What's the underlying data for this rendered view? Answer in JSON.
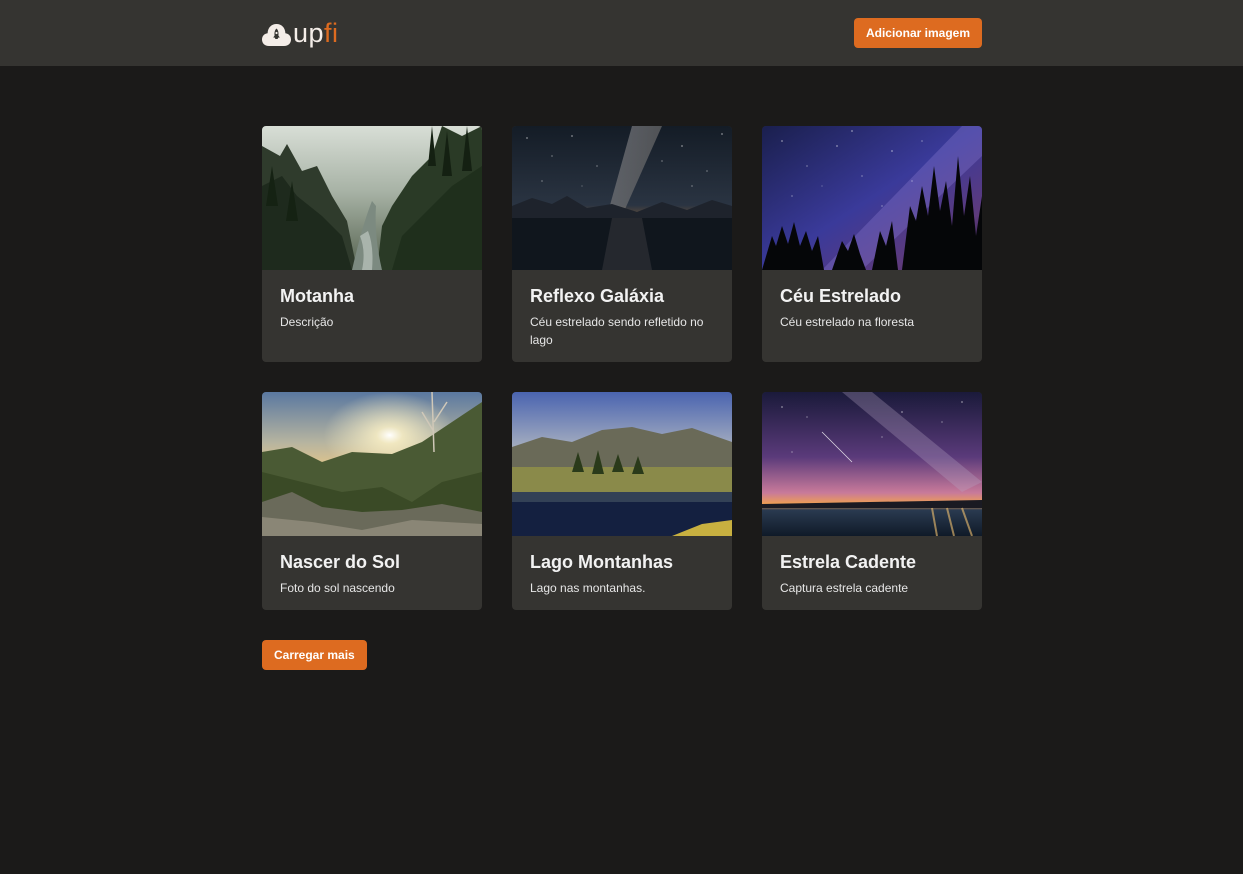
{
  "header": {
    "logo_up": "up",
    "logo_fi": "fi",
    "add_button_label": "Adicionar imagem"
  },
  "cards": [
    {
      "title": "Motanha",
      "description": "Descrição",
      "image": "misty-forest-valley"
    },
    {
      "title": "Reflexo Galáxia",
      "description": "Céu estrelado sendo refletido no lago",
      "image": "milky-way-lake-reflection"
    },
    {
      "title": "Céu Estrelado",
      "description": "Céu estrelado na floresta",
      "image": "starry-sky-forest"
    },
    {
      "title": "Nascer do Sol",
      "description": "Foto do sol nascendo",
      "image": "sunrise-mountains"
    },
    {
      "title": "Lago Montanhas",
      "description": "Lago nas montanhas.",
      "image": "mountain-lake"
    },
    {
      "title": "Estrela Cadente",
      "description": "Captura estrela cadente",
      "image": "shooting-star-coast"
    }
  ],
  "load_more_label": "Carregar mais",
  "colors": {
    "background": "#1b1a19",
    "header": "#353431",
    "card": "#353431",
    "accent": "#dd6b20"
  }
}
